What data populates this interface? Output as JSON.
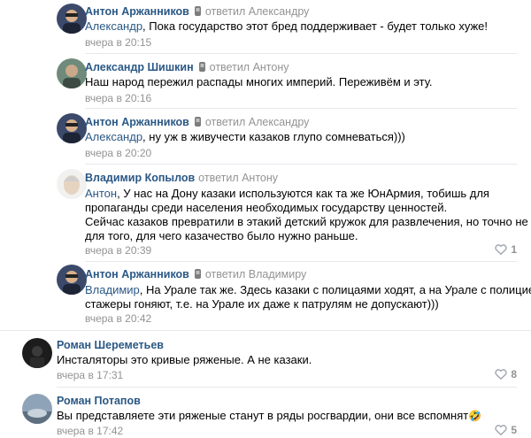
{
  "colors": {
    "link": "#2a5885",
    "muted": "#939393",
    "divider": "#e7e8ec"
  },
  "comments": [
    {
      "author": "Антон Аржанников",
      "reply": "ответил Александру",
      "mention": "Александр",
      "text": ", Пока государство этот бред поддерживает - будет только хуже!",
      "date": "вчера в 20:15"
    },
    {
      "author": "Александр Шишкин",
      "reply": "ответил Антону",
      "text": "Наш народ пережил распады многих империй. Переживём и эту.",
      "date": "вчера в 20:16"
    },
    {
      "author": "Антон Аржанников",
      "reply": "ответил Александру",
      "mention": "Александр",
      "text": ", ну уж в живучести казаков глупо сомневаться)))",
      "date": "вчера в 20:20"
    },
    {
      "author": "Владимир Копылов",
      "reply": "ответил Антону",
      "mention": "Антон",
      "text": ", У нас на Дону казаки используются как та же ЮнАрмия, тобишь для",
      "lines": [
        "пропаганды среди населения необходимых государству ценностей.",
        "Сейчас казаков превратили в этакий детский кружок для развлечения, но точно не",
        "для того, для чего казачество было нужно раньше."
      ],
      "date": "вчера в 20:39",
      "likes": "1"
    },
    {
      "author": "Антон Аржанников",
      "reply": "ответил Владимиру",
      "mention": "Владимир",
      "text": ", На Урале так же. Здесь казаки с полицаями ходят, а на Урале с полицией",
      "lines": [
        "стажеры гоняют, т.е. на Урале их даже к патрулям не допускают)))"
      ],
      "date": "вчера в 20:42"
    },
    {
      "author": "Роман Шереметьев",
      "text": "Инсталяторы это кривые ряженые. А не казаки.",
      "date": "вчера в 17:31",
      "likes": "8"
    },
    {
      "author": "Роман Потапов",
      "text": "Вы представляете эти ряженые станут в ряды росгвардии, они все вспомнят",
      "emoji": "🤣",
      "date": "вчера в 17:42",
      "likes": "5"
    }
  ]
}
